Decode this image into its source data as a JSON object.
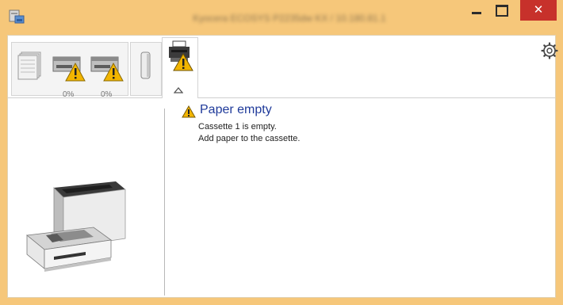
{
  "window": {
    "title": "Kyocera ECOSYS P2235dw KX / 10.180.81.1",
    "minimize_label": "_",
    "close_label": "✕"
  },
  "tabs": [
    {
      "name": "paper",
      "icon": "paper-stack-icon"
    },
    {
      "name": "toner-1",
      "icon": "toner-warning-icon",
      "percent": "0%"
    },
    {
      "name": "toner-2",
      "icon": "toner-warning-icon",
      "percent": "0%"
    },
    {
      "name": "cartridge",
      "icon": "cartridge-icon"
    },
    {
      "name": "printer-status",
      "icon": "printer-warning-icon",
      "active": true
    }
  ],
  "status": {
    "title": "Paper empty",
    "line1": "Cassette 1 is empty.",
    "line2": "Add paper to the cassette."
  },
  "colors": {
    "frame": "#f6c77a",
    "close": "#c7312b",
    "title_text": "#1f3a9a",
    "warning": "#f2b500"
  }
}
